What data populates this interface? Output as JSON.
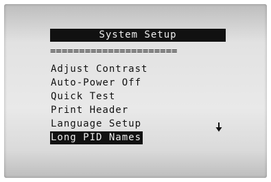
{
  "screen": {
    "title": "System Setup",
    "divider": "======================",
    "menu_items": [
      {
        "label": "Adjust Contrast",
        "selected": false
      },
      {
        "label": "Auto-Power Off",
        "selected": false
      },
      {
        "label": "Quick Test",
        "selected": false
      },
      {
        "label": "Print Header",
        "selected": false
      },
      {
        "label": "Language Setup",
        "selected": false
      },
      {
        "label": "Long PID Names",
        "selected": true
      }
    ],
    "scroll_indicator_icon": "down-arrow-icon"
  }
}
